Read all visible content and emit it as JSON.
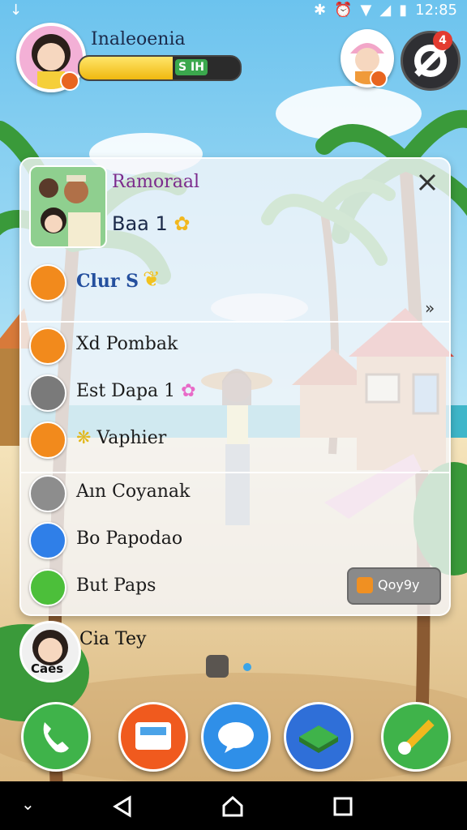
{
  "status_bar": {
    "time": "12:85",
    "icons": [
      "download-arrow-icon",
      "bluetooth-icon",
      "alarm-icon",
      "wifi-icon",
      "signal-icon",
      "battery-icon"
    ]
  },
  "hud": {
    "player_name": "Inaleoenia",
    "level_badge": "S IH",
    "xp_progress": 0.58,
    "settings_notification": "4"
  },
  "panel": {
    "title": "Ramoraal",
    "subtitle": "Baa 1",
    "menu": [
      {
        "label": "Clur S",
        "icon": "pencil-icon",
        "color": "#f28a1c"
      },
      {
        "label": "Xd Pombak",
        "icon": "x-badge-icon",
        "color": "#f28a1c"
      },
      {
        "label": "Est Dapa 1",
        "icon": "brush-icon",
        "color": "#7a7a7a"
      },
      {
        "label": "Vaphier",
        "icon": "bird-icon",
        "color": "#f28a1c"
      },
      {
        "label": "Aın Coyanak",
        "icon": "coin-icon",
        "color": "#8d8d8d"
      },
      {
        "label": "Bo Papodao",
        "icon": "bottle-icon",
        "color": "#2f7fe8"
      },
      {
        "label": "But Paps",
        "icon": "card-icon",
        "color": "#4cbf3a"
      }
    ],
    "action_button": "Qoy9y"
  },
  "friend": {
    "name": "Cia Tey",
    "tag": "Caes"
  },
  "dock": [
    {
      "icon": "phone-icon",
      "color": "#3fb34a"
    },
    {
      "icon": "tv-icon",
      "color": "#f05a1e"
    },
    {
      "icon": "chat-bubble-icon",
      "color": "#2f8fe8"
    },
    {
      "icon": "map-icon",
      "color": "#2f6fd8"
    },
    {
      "icon": "paintbrush-icon",
      "color": "#3fb34a"
    }
  ],
  "colors": {
    "sky": "#8fd3f0",
    "sand": "#f0dcae",
    "panel_title": "#7b2a8c"
  }
}
